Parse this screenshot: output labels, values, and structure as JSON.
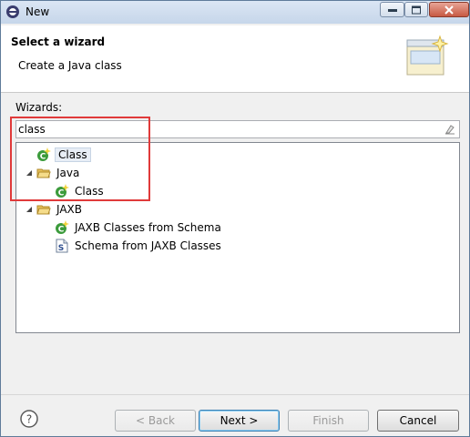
{
  "window": {
    "title": "New"
  },
  "header": {
    "title": "Select a wizard",
    "subtitle": "Create a Java class"
  },
  "wizards": {
    "label": "Wizards:",
    "filter_value": "class",
    "tree": [
      {
        "label": "Class",
        "icon": "class-icon",
        "level": 0,
        "expander": "none",
        "selected": true
      },
      {
        "label": "Java",
        "icon": "folder-icon",
        "level": 0,
        "expander": "expanded"
      },
      {
        "label": "Class",
        "icon": "class-icon",
        "level": 1,
        "expander": "none"
      },
      {
        "label": "JAXB",
        "icon": "folder-icon",
        "level": 0,
        "expander": "expanded"
      },
      {
        "label": "JAXB Classes from Schema",
        "icon": "class-icon",
        "level": 1,
        "expander": "none"
      },
      {
        "label": "Schema from JAXB Classes",
        "icon": "schema-file-icon",
        "level": 1,
        "expander": "none"
      }
    ]
  },
  "buttons": {
    "back": "< Back",
    "next": "Next >",
    "finish": "Finish",
    "cancel": "Cancel"
  },
  "colors": {
    "highlight_annotation": "#e03a3a",
    "class_icon_green": "#3b9b3b",
    "folder_yellow": "#e8c15a"
  }
}
